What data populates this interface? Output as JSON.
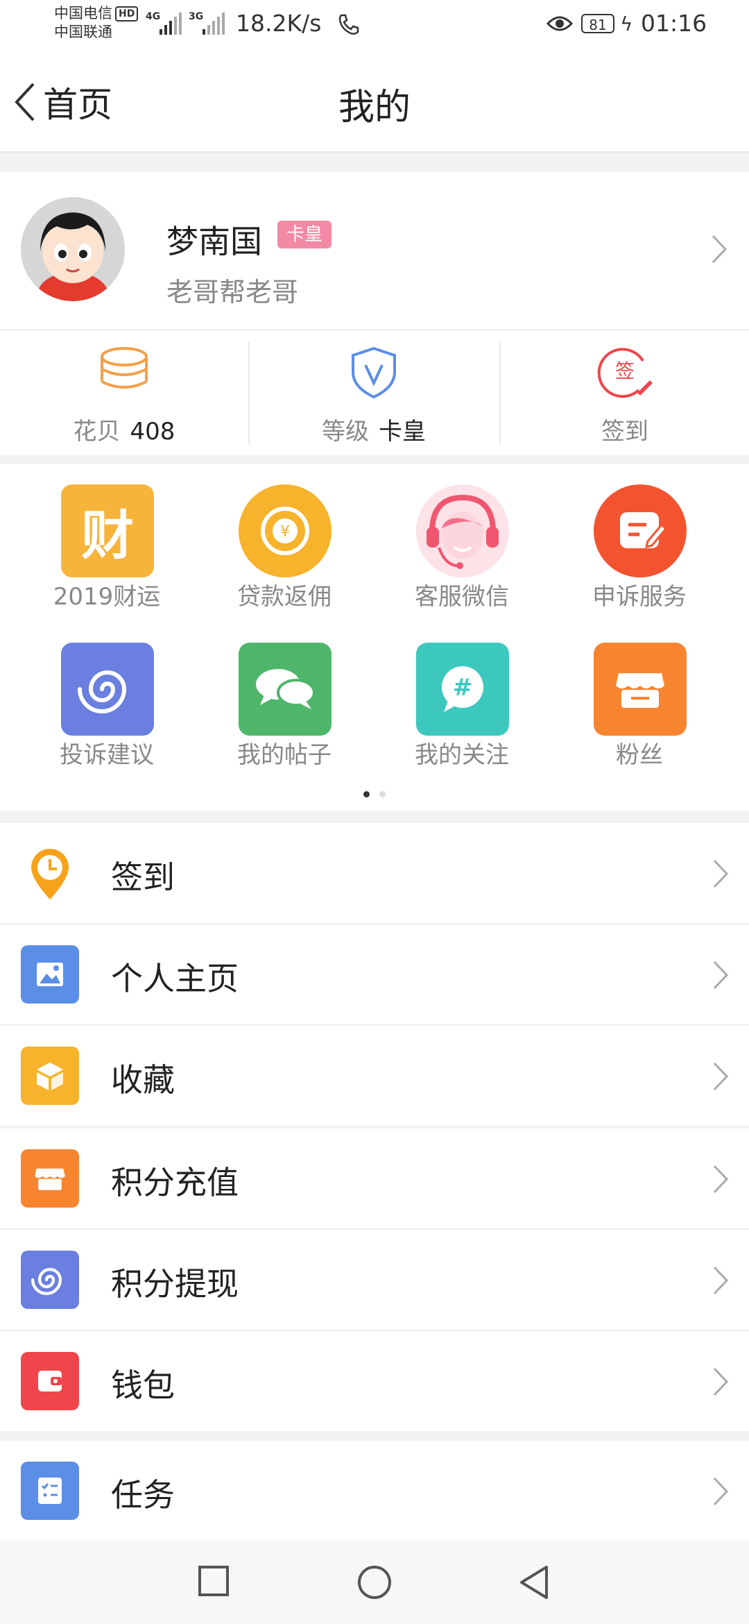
{
  "status_bar": {
    "carrier1": "中国电信",
    "hd": "HD",
    "carrier2": "中国联通",
    "net1": "4G",
    "net2": "3G",
    "speed": "18.2K/s",
    "battery": "81",
    "time": "01:16"
  },
  "nav": {
    "back_label": "首页",
    "title": "我的"
  },
  "profile": {
    "name": "梦南国",
    "badge": "卡皇",
    "signature": "老哥帮老哥"
  },
  "stats": [
    {
      "label": "花贝",
      "value": "408",
      "icon": "coins-icon"
    },
    {
      "label": "等级",
      "value": "卡皇",
      "icon": "shield-v-icon"
    },
    {
      "label": "签到",
      "value": "",
      "icon": "sign-in-icon"
    }
  ],
  "grid": [
    {
      "label": "2019财运",
      "icon": "fortune-icon",
      "color": "#f7b43a"
    },
    {
      "label": "贷款返佣",
      "icon": "coin-yen-icon",
      "color": "#f7b32b"
    },
    {
      "label": "客服微信",
      "icon": "customer-service-icon",
      "color": "#f36f8b"
    },
    {
      "label": "申诉服务",
      "icon": "appeal-icon",
      "color": "#f3532f"
    },
    {
      "label": "投诉建议",
      "icon": "spiral-icon",
      "color": "#6a7fe0"
    },
    {
      "label": "我的帖子",
      "icon": "chat-icon",
      "color": "#4fb56b"
    },
    {
      "label": "我的关注",
      "icon": "hashtag-icon",
      "color": "#3dc8be"
    },
    {
      "label": "粉丝",
      "icon": "store-icon",
      "color": "#f7842f"
    }
  ],
  "grid_letter": "财",
  "list1": [
    {
      "label": "签到",
      "icon": "clock-pin-icon",
      "color": "#f7a21b"
    },
    {
      "label": "个人主页",
      "icon": "image-icon",
      "color": "#5b8ee6"
    },
    {
      "label": "收藏",
      "icon": "box-icon",
      "color": "#f7b32b"
    }
  ],
  "list2": [
    {
      "label": "积分充值",
      "icon": "store-icon",
      "color": "#f7842f"
    },
    {
      "label": "积分提现",
      "icon": "spiral-icon",
      "color": "#6a7fe0"
    },
    {
      "label": "钱包",
      "icon": "wallet-icon",
      "color": "#f0464b"
    }
  ],
  "list3": [
    {
      "label": "任务",
      "icon": "tasks-icon",
      "color": "#5b8ee6"
    }
  ]
}
